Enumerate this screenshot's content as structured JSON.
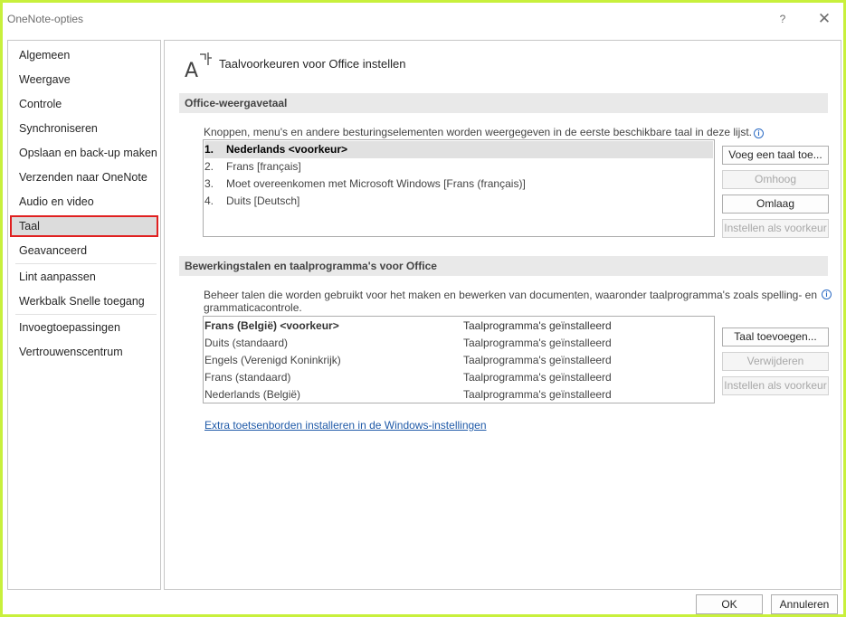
{
  "window": {
    "title": "OneNote-opties",
    "help_glyph": "?",
    "close_glyph": "✕"
  },
  "sidebar": {
    "items": [
      "Algemeen",
      "Weergave",
      "Controle",
      "Synchroniseren",
      "Opslaan en back-up maken",
      "Verzenden naar OneNote",
      "Audio en video",
      "Taal",
      "Geavanceerd",
      "Lint aanpassen",
      "Werkbalk Snelle toegang",
      "Invoegtoepassingen",
      "Vertrouwenscentrum"
    ],
    "selected": "Taal"
  },
  "header": {
    "title": "Taalvoorkeuren voor Office instellen",
    "icon": "language-icon"
  },
  "display_language": {
    "section_title": "Office-weergavetaal",
    "description": "Knoppen, menu's en andere besturingselementen worden weergegeven in de eerste beschikbare taal in deze lijst.",
    "list": [
      {
        "num": "1.",
        "label": "Nederlands <voorkeur>",
        "selected": true
      },
      {
        "num": "2.",
        "label": "Frans [français]",
        "selected": false
      },
      {
        "num": "3.",
        "label": "Moet overeenkomen met Microsoft Windows [Frans (français)]",
        "selected": false
      },
      {
        "num": "4.",
        "label": "Duits [Deutsch]",
        "selected": false
      }
    ],
    "buttons": {
      "add": "Voeg een taal toe...",
      "up": "Omhoog",
      "down": "Omlaag",
      "set_preferred": "Instellen als voorkeur"
    }
  },
  "editing_language": {
    "section_title": "Bewerkingstalen en taalprogramma's voor Office",
    "description_line1": "Beheer talen die worden gebruikt voor het maken en bewerken van documenten, waaronder taalprogramma's zoals spelling- en",
    "description_line2": "grammaticacontrole.",
    "rows": [
      {
        "language": "Frans (België) <voorkeur>",
        "status": "Taalprogramma's geïnstalleerd",
        "bold": true
      },
      {
        "language": "Duits (standaard)",
        "status": "Taalprogramma's geïnstalleerd",
        "bold": false
      },
      {
        "language": "Engels (Verenigd Koninkrijk)",
        "status": "Taalprogramma's geïnstalleerd",
        "bold": false
      },
      {
        "language": "Frans (standaard)",
        "status": "Taalprogramma's geïnstalleerd",
        "bold": false
      },
      {
        "language": "Nederlands (België)",
        "status": "Taalprogramma's geïnstalleerd",
        "bold": false
      }
    ],
    "buttons": {
      "add": "Taal toevoegen...",
      "remove": "Verwijderen",
      "set_preferred": "Instellen als voorkeur"
    },
    "link": "Extra toetsenborden installeren in de Windows-instellingen"
  },
  "footer": {
    "ok": "OK",
    "cancel": "Annuleren"
  },
  "colors": {
    "accent_border": "#c8f03c",
    "selected_outline": "#e02020",
    "link": "#1f5aa8"
  }
}
